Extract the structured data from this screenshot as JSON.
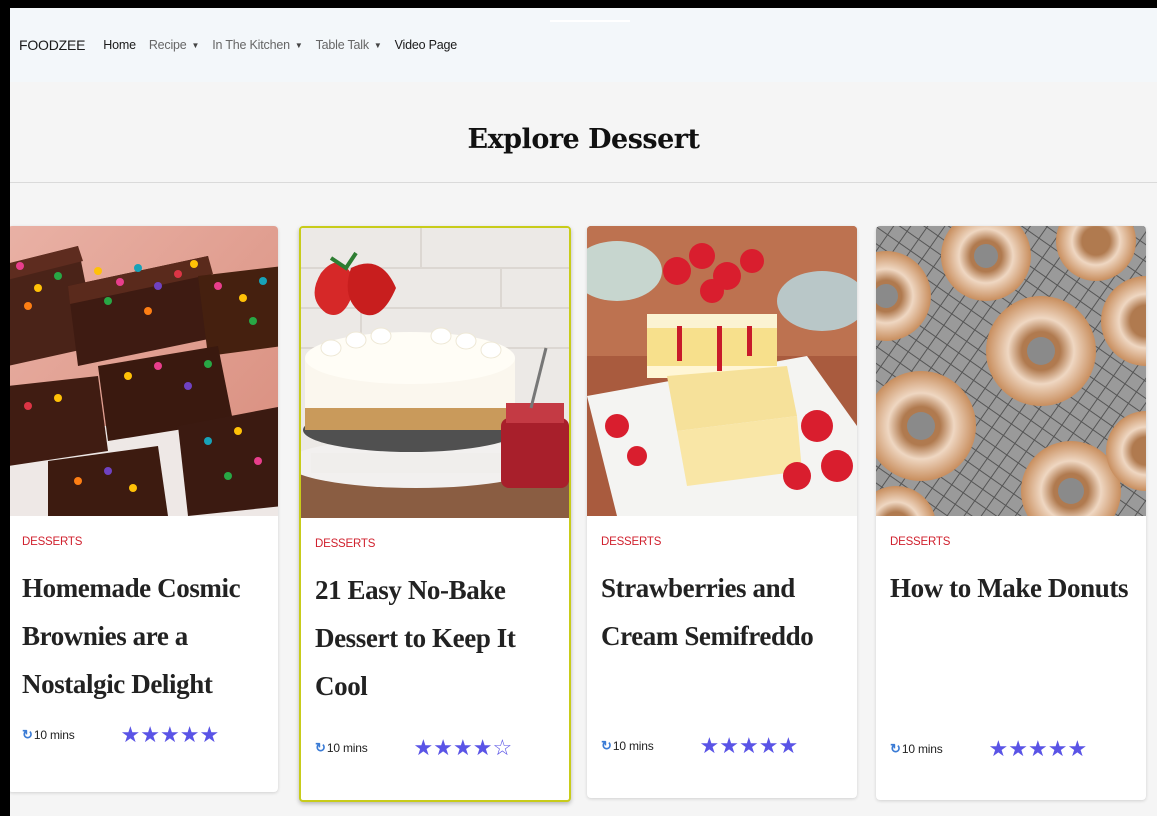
{
  "nav": {
    "brand": "FOODZEE",
    "items": [
      {
        "label": "Home",
        "dropdown": false,
        "style": "dark"
      },
      {
        "label": "Recipe",
        "dropdown": true,
        "style": "gray"
      },
      {
        "label": "In The Kitchen",
        "dropdown": true,
        "style": "gray"
      },
      {
        "label": "Table Talk",
        "dropdown": true,
        "style": "gray"
      },
      {
        "label": "Video Page",
        "dropdown": false,
        "style": "dark"
      }
    ]
  },
  "page": {
    "title": "Explore Dessert"
  },
  "cards": [
    {
      "category": "DESSERTS",
      "title": "Homemade Cosmic Brownies are a Nostalgic Delight",
      "time": "10 mins",
      "rating": 5,
      "image": "brownies"
    },
    {
      "category": "DESSERTS",
      "title": "21 Easy No-Bake Dessert to Keep It Cool",
      "time": "10 mins",
      "rating": 4,
      "image": "cheesecake"
    },
    {
      "category": "DESSERTS",
      "title": "Strawberries and Cream Semifreddo",
      "time": "10 mins",
      "rating": 5,
      "image": "semifreddo"
    },
    {
      "category": "DESSERTS",
      "title": "How to Make Donuts",
      "time": "10 mins",
      "rating": 5,
      "image": "donuts"
    }
  ],
  "colors": {
    "category": "#d0212e",
    "star": "#5a54e6",
    "clock": "#3a7bd5",
    "selected_border": "#c8cc1a"
  },
  "icons": {
    "clock": "clock-icon",
    "star": "star-icon",
    "caret": "caret-down-icon"
  }
}
